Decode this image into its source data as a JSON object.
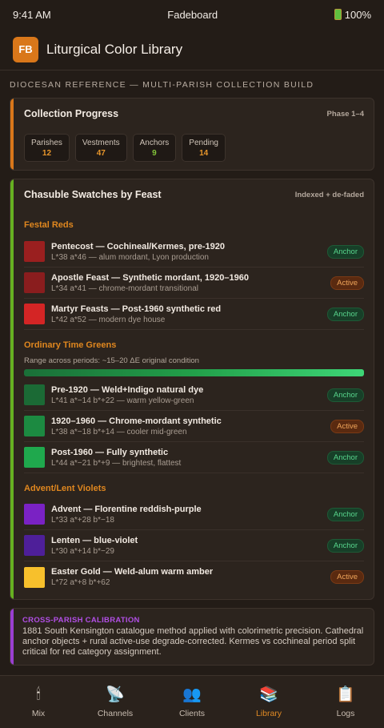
{
  "status": {
    "time": "9:41 AM",
    "carrier": "Fadeboard",
    "battery": "100%"
  },
  "header": {
    "logo": "FB",
    "title": "Liturgical Color Library"
  },
  "section_caption": "DIOCESAN REFERENCE — MULTI-PARISH COLLECTION BUILD",
  "progress": {
    "title": "Collection Progress",
    "tag": "Phase 1–4",
    "stats": [
      {
        "label": "Parishes",
        "value": "12"
      },
      {
        "label": "Vestments",
        "value": "47"
      },
      {
        "label": "Anchors",
        "value": "9"
      },
      {
        "label": "Pending",
        "value": "14"
      }
    ]
  },
  "swatches": {
    "title": "Chasuble Swatches by Feast",
    "tag": "Indexed + de-faded",
    "groups": [
      {
        "title": "Festal Reds",
        "items": [
          {
            "name": "Pentecost — Cochineal/Kermes, pre-1920",
            "sub": "L*38 a*46 — alum mordant, Lyon production",
            "badge": "Anchor",
            "color": "#9a1f1f"
          },
          {
            "name": "Apostle Feast — Synthetic mordant, 1920–1960",
            "sub": "L*34 a*41 — chrome-mordant transitional",
            "badge": "Active",
            "color": "#8a1d1e"
          },
          {
            "name": "Martyr Feasts — Post-1960 synthetic red",
            "sub": "L*42 a*52 — modern dye house",
            "badge": "Anchor",
            "color": "#d42525"
          }
        ]
      },
      {
        "title": "Ordinary Time Greens",
        "range_note": "Range across periods: ~15–20 ΔE original condition",
        "items": [
          {
            "name": "Pre-1920 — Weld+Indigo natural dye",
            "sub": "L*41 a*−14 b*+22 — warm yellow-green",
            "badge": "Anchor",
            "color": "#1b6a35"
          },
          {
            "name": "1920–1960 — Chrome-mordant synthetic",
            "sub": "L*38 a*−18 b*+14 — cooler mid-green",
            "badge": "Active",
            "color": "#1c8a41"
          },
          {
            "name": "Post-1960 — Fully synthetic",
            "sub": "L*44 a*−21 b*+9 — brightest, flattest",
            "badge": "Anchor",
            "color": "#1fa84d"
          }
        ]
      },
      {
        "title": "Advent/Lent Violets",
        "items": [
          {
            "name": "Advent — Florentine reddish-purple",
            "sub": "L*33 a*+28 b*−18",
            "badge": "Anchor",
            "color": "#7a22c4"
          },
          {
            "name": "Lenten — blue-violet",
            "sub": "L*30 a*+14 b*−29",
            "badge": "Anchor",
            "color": "#4e1f99"
          },
          {
            "name": "Easter Gold — Weld-alum warm amber",
            "sub": "L*72 a*+8 b*+62",
            "badge": "Active",
            "color": "#f7c02c"
          }
        ]
      }
    ]
  },
  "calibration": {
    "title": "CROSS-PARISH CALIBRATION",
    "body": "1881 South Kensington catalogue method applied with colorimetric precision. Cathedral anchor objects + rural active-use degrade-corrected. Kermes vs cochineal period split critical for red category assignment."
  },
  "tabs": [
    {
      "label": "Mix",
      "icon": "🕯",
      "icon_name": "candle-icon"
    },
    {
      "label": "Channels",
      "icon": "📡",
      "icon_name": "satellite-icon"
    },
    {
      "label": "Clients",
      "icon": "👥",
      "icon_name": "people-icon"
    },
    {
      "label": "Library",
      "icon": "📚",
      "icon_name": "books-icon"
    },
    {
      "label": "Logs",
      "icon": "📋",
      "icon_name": "clipboard-icon"
    }
  ],
  "active_tab": "Library"
}
